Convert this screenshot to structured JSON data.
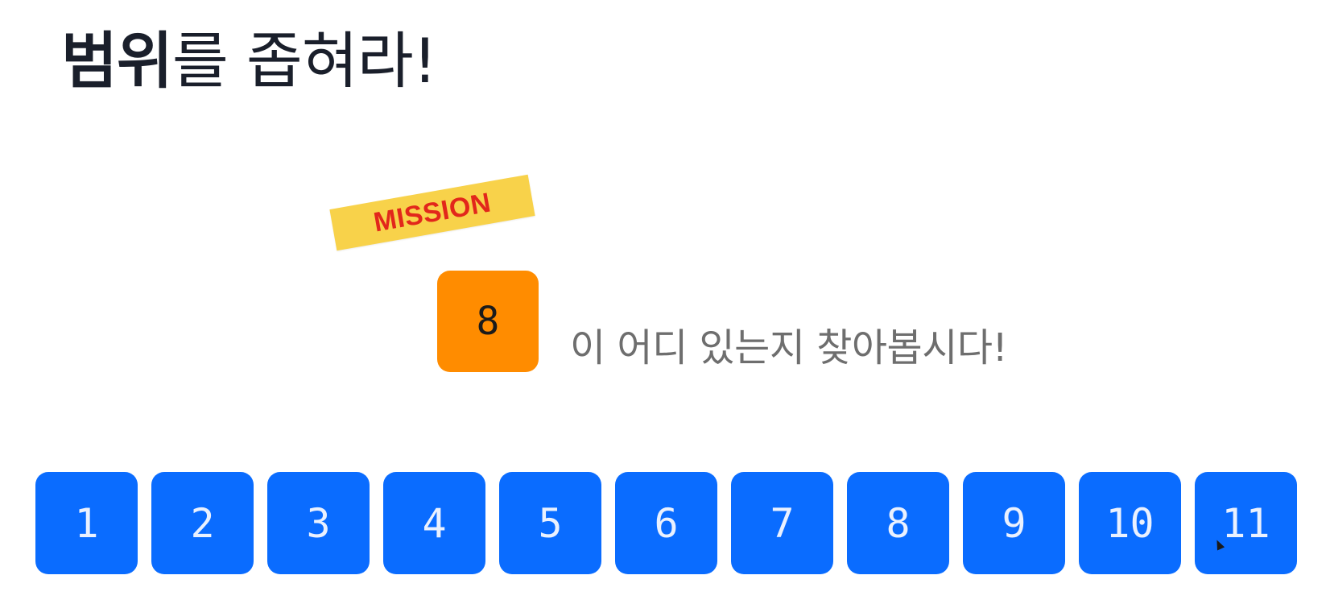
{
  "title": {
    "bold": "범위",
    "rest": "를 좁혀라!"
  },
  "mission": {
    "tag": "MISSION",
    "target": "8",
    "text": "이 어디 있는지 찾아봅시다!"
  },
  "cards": [
    "1",
    "2",
    "3",
    "4",
    "5",
    "6",
    "7",
    "8",
    "9",
    "10",
    "11"
  ],
  "colors": {
    "card": "#0a6cff",
    "target": "#ff8c00",
    "tag_bg": "#f8d24a",
    "tag_text": "#e2271b"
  }
}
